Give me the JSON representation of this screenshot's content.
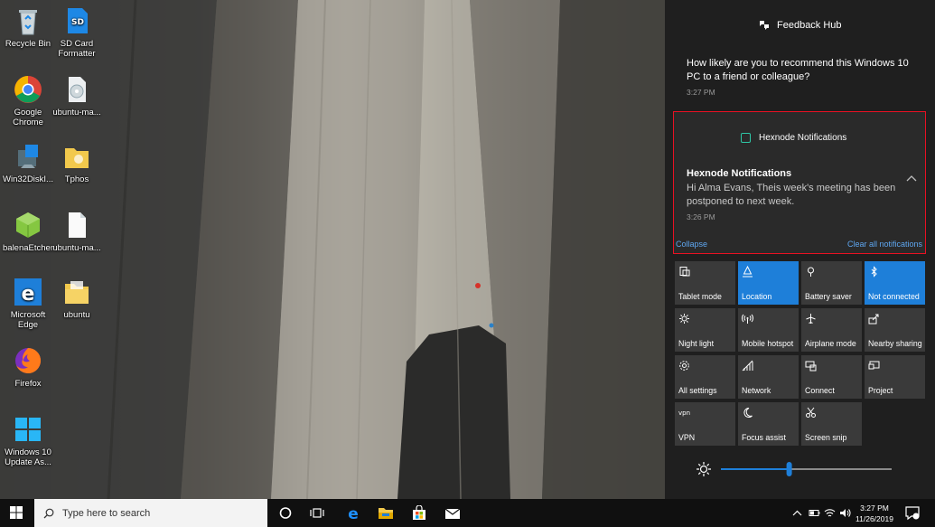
{
  "desktop": {
    "icons": [
      {
        "label": "Recycle Bin"
      },
      {
        "label": "SD Card Formatter"
      },
      {
        "label": "Google Chrome"
      },
      {
        "label": "ubuntu-ma..."
      },
      {
        "label": "Win32DiskI..."
      },
      {
        "label": "Tphos"
      },
      {
        "label": "balenaEtcher"
      },
      {
        "label": "ubuntu-ma..."
      },
      {
        "label": "Microsoft Edge"
      },
      {
        "label": "ubuntu"
      },
      {
        "label": "Firefox"
      },
      {
        "label": "Windows 10 Update As..."
      }
    ]
  },
  "action_center": {
    "feedback_hub": {
      "app_name": "Feedback Hub",
      "message": "How likely are you to recommend this Windows 10 PC to a friend or colleague?",
      "time": "3:27 PM"
    },
    "hexnode": {
      "app_name": "Hexnode Notifications",
      "title": "Hexnode Notifications",
      "message": "Hi Alma Evans, Theis week's meeting has been postponed to next week.",
      "time": "3:26 PM",
      "accent": "#e81123"
    },
    "collapse_label": "Collapse",
    "clear_all_label": "Clear all notifications",
    "quick_actions": [
      {
        "label": "Tablet mode",
        "icon": "tablet-icon",
        "on": false
      },
      {
        "label": "Location",
        "icon": "location-icon",
        "on": true
      },
      {
        "label": "Battery saver",
        "icon": "battery-saver-icon",
        "on": false
      },
      {
        "label": "Not connected",
        "icon": "bluetooth-icon",
        "on": true
      },
      {
        "label": "Night light",
        "icon": "night-light-icon",
        "on": false
      },
      {
        "label": "Mobile hotspot",
        "icon": "hotspot-icon",
        "on": false
      },
      {
        "label": "Airplane mode",
        "icon": "airplane-icon",
        "on": false
      },
      {
        "label": "Nearby sharing",
        "icon": "share-icon",
        "on": false
      },
      {
        "label": "All settings",
        "icon": "gear-icon",
        "on": false
      },
      {
        "label": "Network",
        "icon": "network-icon",
        "on": false
      },
      {
        "label": "Connect",
        "icon": "connect-icon",
        "on": false
      },
      {
        "label": "Project",
        "icon": "project-icon",
        "on": false
      },
      {
        "label": "VPN",
        "icon": "vpn-icon",
        "on": false
      },
      {
        "label": "Focus assist",
        "icon": "moon-icon",
        "on": false
      },
      {
        "label": "Screen snip",
        "icon": "snip-icon",
        "on": false
      }
    ],
    "brightness": 0.4
  },
  "taskbar": {
    "search_placeholder": "Type here to search",
    "time": "3:27 PM",
    "date": "11/26/2019",
    "accent": "#1e7fd9"
  }
}
